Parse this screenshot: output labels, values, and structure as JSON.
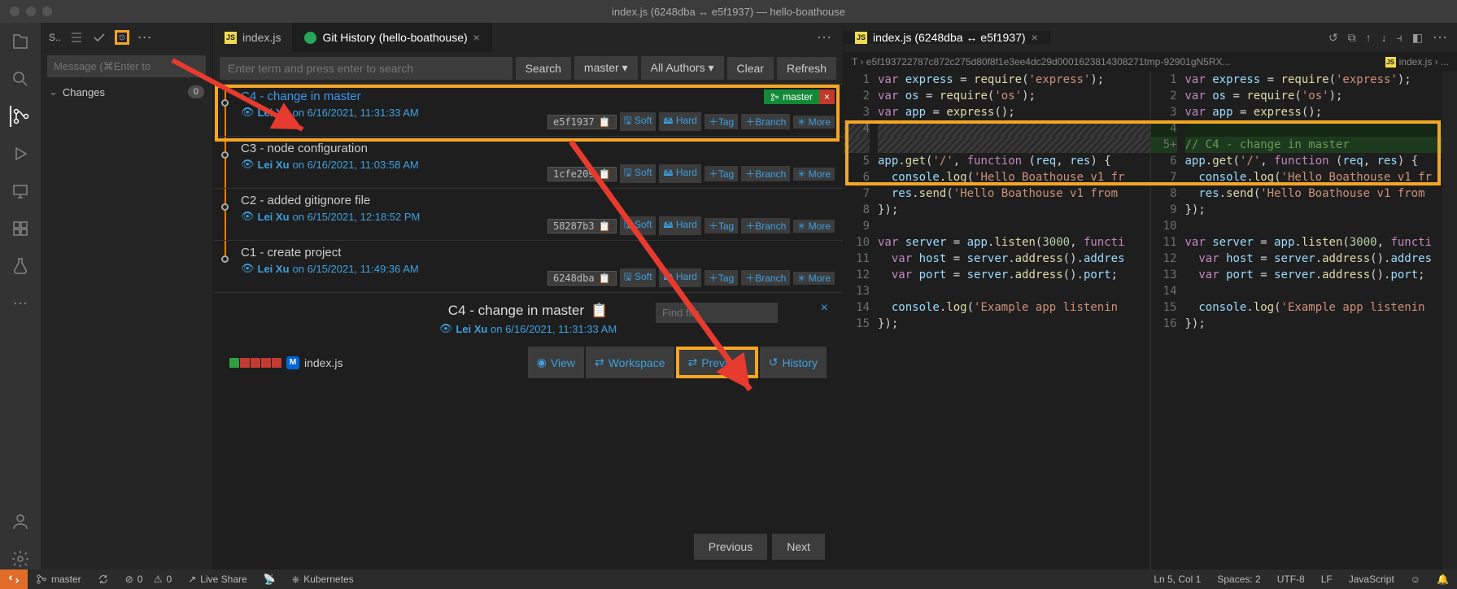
{
  "window": {
    "title": "index.js (6248dba ↔ e5f1937) — hello-boathouse"
  },
  "scm": {
    "sortLabel": "S..",
    "message_placeholder": "Message (⌘Enter to",
    "changes_label": "Changes",
    "changes_count": "0"
  },
  "tabs": {
    "left1": "index.js",
    "left2": "Git History (hello-boathouse)",
    "rightDiff": "index.js (6248dba ↔ e5f1937)"
  },
  "history": {
    "search_placeholder": "Enter term and press enter to search",
    "btn_search": "Search",
    "btn_branch": "master",
    "btn_authors": "All Authors",
    "btn_clear": "Clear",
    "btn_refresh": "Refresh",
    "commits": [
      {
        "title": "C4 - change in master",
        "author": "Lei Xu",
        "date": "6/16/2021, 11:31:33 AM",
        "hash": "e5f1937",
        "branch": "master"
      },
      {
        "title": "C3 - node configuration",
        "author": "Lei Xu",
        "date": "6/16/2021, 11:03:58 AM",
        "hash": "1cfe209"
      },
      {
        "title": "C2 - added gitignore file",
        "author": "Lei Xu",
        "date": "6/15/2021, 12:18:52 PM",
        "hash": "58287b3"
      },
      {
        "title": "C1 - create project",
        "author": "Lei Xu",
        "date": "6/15/2021, 11:49:36 AM",
        "hash": "6248dba"
      }
    ],
    "action_soft": "Soft",
    "action_hard": "Hard",
    "action_tag": "Tag",
    "action_branch": "Branch",
    "action_more": "More"
  },
  "detail": {
    "title": "C4 - change in master",
    "author": "Lei Xu",
    "date": "6/16/2021, 11:31:33 AM",
    "file": "index.js",
    "find_placeholder": "Find file",
    "btn_view": "View",
    "btn_workspace": "Workspace",
    "btn_previous": "Previous",
    "btn_history": "History",
    "pager_prev": "Previous",
    "pager_next": "Next"
  },
  "diff": {
    "breadcrumb_left": "T › e5f193722787c872c275d80f8f1e3ee4dc29d0001623814308271tmp-92901gN5RX...",
    "breadcrumb_right": "index.js › ...",
    "left": {
      "lines": [
        {
          "n": "1",
          "html": "<span class='kw'>var</span> <span class='vr'>express</span> = <span class='fn'>require</span>(<span class='st'>'express'</span>);"
        },
        {
          "n": "2",
          "html": "<span class='kw'>var</span> <span class='vr'>os</span> = <span class='fn'>require</span>(<span class='st'>'os'</span>);"
        },
        {
          "n": "3",
          "html": "<span class='kw'>var</span> <span class='vr'>app</span> = <span class='fn'>express</span>();"
        },
        {
          "n": "4",
          "html": "",
          "cls": "hash-removed"
        },
        {
          "n": "",
          "html": "",
          "cls": "hash-removed"
        },
        {
          "n": "5",
          "html": "<span class='vr'>app</span>.<span class='fn'>get</span>(<span class='st'>'/'</span>, <span class='kw'>function</span> (<span class='vr'>req</span>, <span class='vr'>res</span>) {"
        },
        {
          "n": "6",
          "html": "&nbsp;&nbsp;<span class='vr'>console</span>.<span class='fn'>log</span>(<span class='st'>'Hello Boathouse v1 fr</span>"
        },
        {
          "n": "7",
          "html": "&nbsp;&nbsp;<span class='vr'>res</span>.<span class='fn'>send</span>(<span class='st'>'Hello Boathouse v1 from</span>"
        },
        {
          "n": "8",
          "html": "});"
        },
        {
          "n": "9",
          "html": ""
        },
        {
          "n": "10",
          "html": "<span class='kw'>var</span> <span class='vr'>server</span> = <span class='vr'>app</span>.<span class='fn'>listen</span>(<span class='nm'>3000</span>, <span class='kw'>functi</span>"
        },
        {
          "n": "11",
          "html": "&nbsp;&nbsp;<span class='kw'>var</span> <span class='vr'>host</span> = <span class='vr'>server</span>.<span class='fn'>address</span>().<span class='vr'>addres</span>"
        },
        {
          "n": "12",
          "html": "&nbsp;&nbsp;<span class='kw'>var</span> <span class='vr'>port</span> = <span class='vr'>server</span>.<span class='fn'>address</span>().<span class='vr'>port</span>;"
        },
        {
          "n": "13",
          "html": ""
        },
        {
          "n": "14",
          "html": "&nbsp;&nbsp;<span class='vr'>console</span>.<span class='fn'>log</span>(<span class='st'>'Example app listenin</span>"
        },
        {
          "n": "15",
          "html": "});"
        }
      ]
    },
    "right": {
      "lines": [
        {
          "n": "1",
          "html": "<span class='kw'>var</span> <span class='vr'>express</span> = <span class='fn'>require</span>(<span class='st'>'express'</span>);"
        },
        {
          "n": "2",
          "html": "<span class='kw'>var</span> <span class='vr'>os</span> = <span class='fn'>require</span>(<span class='st'>'os'</span>);"
        },
        {
          "n": "3",
          "html": "<span class='kw'>var</span> <span class='vr'>app</span> = <span class='fn'>express</span>();"
        },
        {
          "n": "4",
          "html": "",
          "cls": "added-bg-dim"
        },
        {
          "n": "5",
          "html": "<span class='cm'>// C4 - change in master</span>",
          "cls": "added-bg",
          "plus": true
        },
        {
          "n": "6",
          "html": "<span class='vr'>app</span>.<span class='fn'>get</span>(<span class='st'>'/'</span>, <span class='kw'>function</span> (<span class='vr'>req</span>, <span class='vr'>res</span>) {"
        },
        {
          "n": "7",
          "html": "&nbsp;&nbsp;<span class='vr'>console</span>.<span class='fn'>log</span>(<span class='st'>'Hello Boathouse v1 fr</span>"
        },
        {
          "n": "8",
          "html": "&nbsp;&nbsp;<span class='vr'>res</span>.<span class='fn'>send</span>(<span class='st'>'Hello Boathouse v1 from</span>"
        },
        {
          "n": "9",
          "html": "});"
        },
        {
          "n": "10",
          "html": ""
        },
        {
          "n": "11",
          "html": "<span class='kw'>var</span> <span class='vr'>server</span> = <span class='vr'>app</span>.<span class='fn'>listen</span>(<span class='nm'>3000</span>, <span class='kw'>functi</span>"
        },
        {
          "n": "12",
          "html": "&nbsp;&nbsp;<span class='kw'>var</span> <span class='vr'>host</span> = <span class='vr'>server</span>.<span class='fn'>address</span>().<span class='vr'>addres</span>"
        },
        {
          "n": "13",
          "html": "&nbsp;&nbsp;<span class='kw'>var</span> <span class='vr'>port</span> = <span class='vr'>server</span>.<span class='fn'>address</span>().<span class='vr'>port</span>;"
        },
        {
          "n": "14",
          "html": ""
        },
        {
          "n": "15",
          "html": "&nbsp;&nbsp;<span class='vr'>console</span>.<span class='fn'>log</span>(<span class='st'>'Example app listenin</span>"
        },
        {
          "n": "16",
          "html": "});"
        }
      ]
    }
  },
  "status": {
    "branch": "master",
    "errors": "0",
    "warnings": "0",
    "live": "Live Share",
    "kube": "Kubernetes",
    "pos": "Ln 5, Col 1",
    "spaces": "Spaces: 2",
    "enc": "UTF-8",
    "eol": "LF",
    "lang": "JavaScript"
  }
}
